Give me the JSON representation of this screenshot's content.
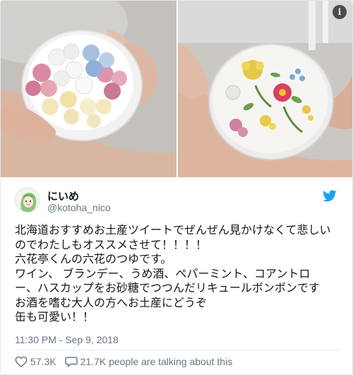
{
  "tweet": {
    "display_name": "にいめ",
    "handle": "@kotoha_nico",
    "text_lines": [
      "北海道おすすめお土産ツイートでぜんぜん見かけなくて悲しい",
      "のでわたしもオススメさせて！！！！",
      "六花亭くんの六花のつゆです。",
      "ワイン、 ブランデー、うめ酒、ペパーミント、コアントロ",
      "ー、ハスカップをお砂糖でつつんだリキュールボンボンです",
      "お酒を嗜む大人の方へお土産にどうぞ",
      "缶も可愛い！！"
    ],
    "timestamp": "11:30 PM - Sep 9, 2018"
  },
  "actions": {
    "likes": "57.3K",
    "talking": "21.7K people are talking about this"
  },
  "media": {
    "info_badge": "i"
  },
  "icons": {
    "bird": "twitter-bird-icon",
    "info": "info-icon",
    "heart": "heart-icon",
    "comment": "speech-bubble-icon"
  },
  "colors": {
    "twitter_blue": "#1da1f2",
    "secondary_text": "#657786",
    "primary_text": "#14171a"
  }
}
